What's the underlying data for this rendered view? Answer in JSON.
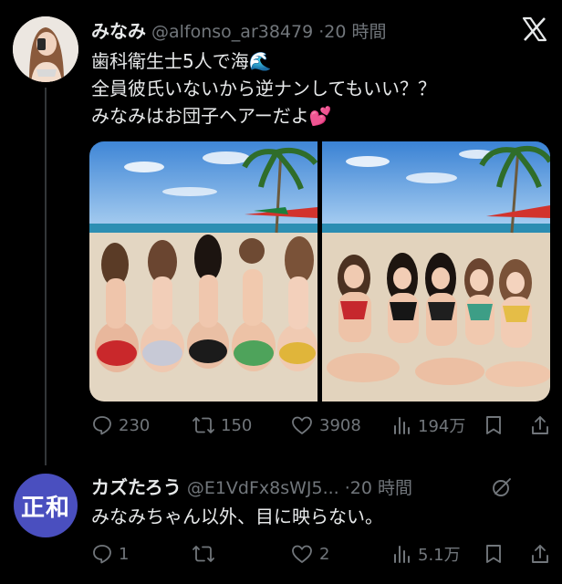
{
  "tweet": {
    "display_name": "みなみ",
    "handle": "@alfonso_ar38479",
    "time": "·20 時間",
    "lines": [
      "歯科衛生士5人で海🌊",
      "全員彼氏いないから逆ナンしてもいい？？",
      "みなみはお団子ヘアーだよ💕"
    ],
    "replies": "230",
    "reposts": "150",
    "likes": "3908",
    "views": "194万"
  },
  "reply": {
    "avatar_text": "正和",
    "display_name": "カズたろう",
    "handle": "@E1VdFx8sWJ5...",
    "time": "·20 時間",
    "text": "みなみちゃん以外、目に映らない。",
    "replies": "1",
    "reposts": "",
    "likes": "2",
    "views": "5.1万"
  },
  "colors": {
    "background": "#000000",
    "text": "#e7e9ea",
    "muted": "#71767b",
    "thread_line": "#333639",
    "reply_avatar": "#4a4fbf"
  },
  "icons": [
    "x-logo-icon",
    "reply-icon",
    "repost-icon",
    "like-icon",
    "views-icon",
    "bookmark-icon",
    "share-icon",
    "grok-icon"
  ]
}
